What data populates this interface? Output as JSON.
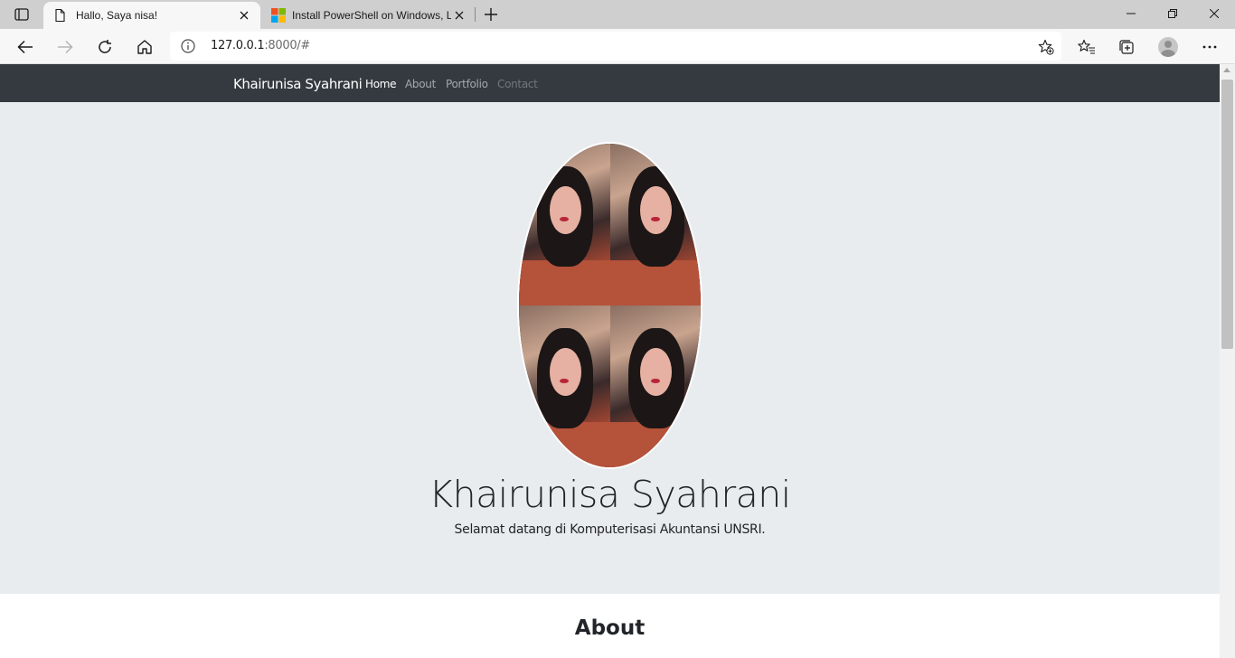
{
  "browser": {
    "tabs": [
      {
        "title": "Hallo, Saya nisa!",
        "icon": "page-icon",
        "active": true
      },
      {
        "title": "Install PowerShell on Windows, L",
        "icon": "microsoft-logo-icon",
        "active": false
      }
    ],
    "address": {
      "host": "127.0.0.1",
      "rest": ":8000/#"
    },
    "toolbar_icons": [
      "back-icon",
      "forward-icon",
      "refresh-icon",
      "home-icon",
      "info-icon",
      "add-favorite-icon",
      "favorites-icon",
      "collections-icon",
      "profile-avatar",
      "more-icon"
    ]
  },
  "site": {
    "brand": "Khairunisa Syahrani",
    "nav": [
      {
        "label": "Home",
        "state": "active"
      },
      {
        "label": "About",
        "state": "normal"
      },
      {
        "label": "Portfolio",
        "state": "normal"
      },
      {
        "label": "Contact",
        "state": "muted"
      }
    ],
    "hero": {
      "name": "Khairunisa Syahrani",
      "subtitle": "Selamat datang di Komputerisasi Akuntansi UNSRI."
    },
    "about": {
      "title": "About"
    }
  },
  "colors": {
    "navbar_bg": "#343a40",
    "jumbotron_bg": "#e9ecef",
    "text": "#212529"
  }
}
